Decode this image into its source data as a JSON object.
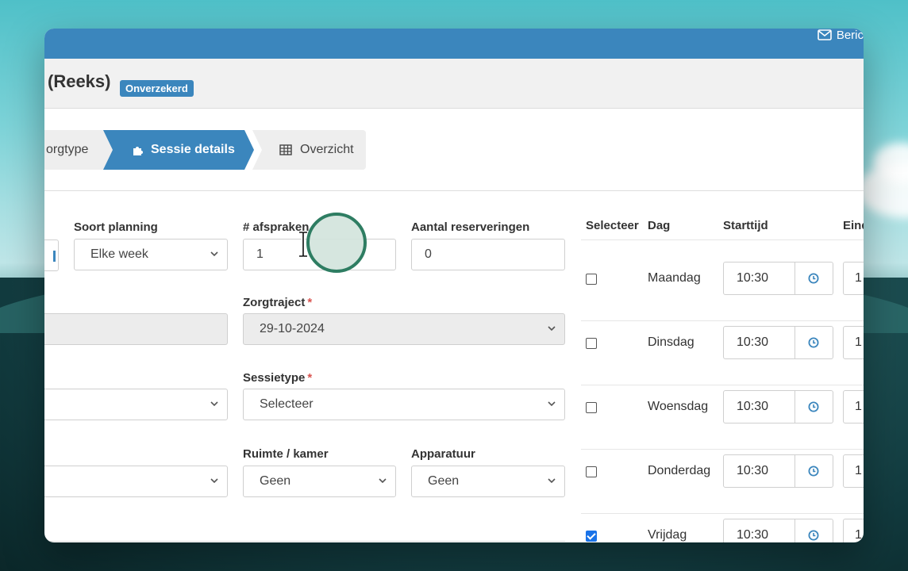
{
  "header": {
    "mail_label": "Beric"
  },
  "page": {
    "title": "(Reeks)",
    "badge": "Onverzekerd"
  },
  "steps": [
    {
      "label": "orgtype",
      "active": false
    },
    {
      "label": "Sessie details",
      "active": true,
      "icon": "puzzle-icon"
    },
    {
      "label": "Overzicht",
      "active": false,
      "icon": "table-icon"
    }
  ],
  "form": {
    "soort_planning": {
      "label": "Soort planning",
      "value": "Elke week"
    },
    "afspraken": {
      "label": "# afspraken",
      "value": "1"
    },
    "aantal_reserveringen": {
      "label": "Aantal reserveringen",
      "value": "0"
    },
    "zorgtraject": {
      "label": "Zorgtraject",
      "value": "29-10-2024"
    },
    "sessietype": {
      "label": "Sessietype",
      "value": "Selecteer"
    },
    "ruimte": {
      "label": "Ruimte / kamer",
      "value": "Geen"
    },
    "apparatuur": {
      "label": "Apparatuur",
      "value": "Geen"
    }
  },
  "schedule": {
    "headers": {
      "select": "Selecteer",
      "day": "Dag",
      "start": "Starttijd",
      "end": "Einde"
    },
    "rows": [
      {
        "day": "Maandag",
        "start": "10:30",
        "end": "1",
        "checked": false
      },
      {
        "day": "Dinsdag",
        "start": "10:30",
        "end": "1",
        "checked": false
      },
      {
        "day": "Woensdag",
        "start": "10:30",
        "end": "1",
        "checked": false
      },
      {
        "day": "Donderdag",
        "start": "10:30",
        "end": "1",
        "checked": false
      },
      {
        "day": "Vrijdag",
        "start": "10:30",
        "end": "1",
        "checked": true
      }
    ]
  },
  "colors": {
    "primary": "#3b86bd",
    "required": "#d9534f",
    "cursor_ring": "#2e7d62"
  }
}
